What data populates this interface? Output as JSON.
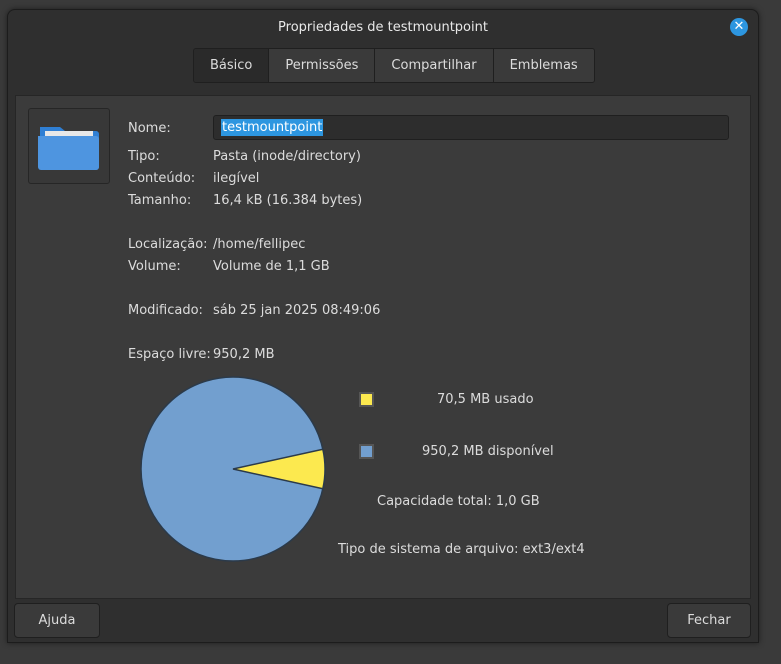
{
  "window": {
    "title": "Propriedades de testmountpoint"
  },
  "tabs": [
    {
      "label": "Básico",
      "active": true
    },
    {
      "label": "Permissões",
      "active": false
    },
    {
      "label": "Compartilhar",
      "active": false
    },
    {
      "label": "Emblemas",
      "active": false
    }
  ],
  "icon": {
    "name": "folder-icon",
    "color": "#4e95e0"
  },
  "props": {
    "name_label": "Nome:",
    "name_value": "testmountpoint",
    "type_label": "Tipo:",
    "type_value": "Pasta (inode/directory)",
    "contents_label": "Conteúdo:",
    "contents_value": "ilegível",
    "size_label": "Tamanho:",
    "size_value": "16,4 kB (16.384 bytes)",
    "location_label": "Localização:",
    "location_value": "/home/fellipec",
    "volume_label": "Volume:",
    "volume_value": "Volume de 1,1 GB",
    "modified_label": "Modificado:",
    "modified_value": "sáb 25 jan 2025 08:49:06",
    "free_label": "Espaço livre:",
    "free_value": "950,2 MB"
  },
  "usage": {
    "used_text": "70,5 MB usado",
    "free_text": "950,2 MB disponível",
    "capacity_text": "Capacidade total: 1,0 GB",
    "fs_text": "Tipo de sistema de arquivo: ext3/ext4",
    "used_fraction": 0.069,
    "used_color": "#fce94f",
    "free_color": "#729fcf"
  },
  "buttons": {
    "help": "Ajuda",
    "close": "Fechar"
  }
}
